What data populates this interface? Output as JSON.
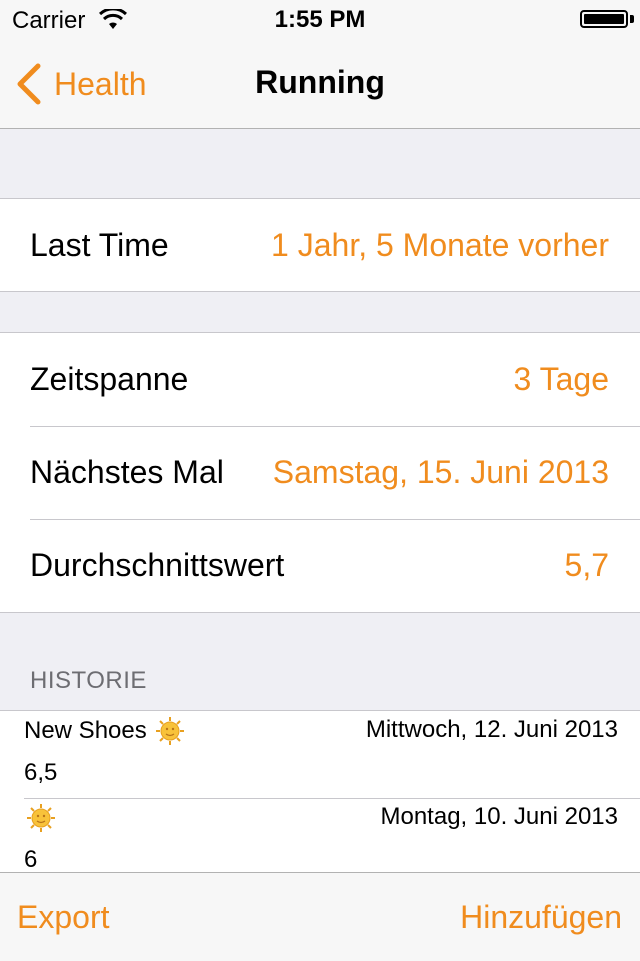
{
  "status_bar": {
    "carrier": "Carrier",
    "time": "1:55 PM"
  },
  "nav": {
    "back_label": "Health",
    "title": "Running"
  },
  "accent_color": "#f08c1e",
  "last_time": {
    "label": "Last Time",
    "value": "1 Jahr, 5 Monate vorher"
  },
  "stats": {
    "rows": [
      {
        "label": "Zeitspanne",
        "value": "3 Tage"
      },
      {
        "label": "Nächstes Mal",
        "value": "Samstag, 15. Juni 2013"
      },
      {
        "label": "Durchschnittswert",
        "value": "5,7"
      }
    ]
  },
  "history": {
    "header": "HISTORIE",
    "items": [
      {
        "title": "New Shoes",
        "icon": "sun-emoji-icon",
        "date": "Mittwoch, 12. Juni 2013",
        "value": "6,5"
      },
      {
        "title": "",
        "icon": "sun-emoji-icon",
        "date": "Montag, 10. Juni 2013",
        "value": "6"
      }
    ]
  },
  "toolbar": {
    "export_label": "Export",
    "add_label": "Hinzufügen"
  }
}
